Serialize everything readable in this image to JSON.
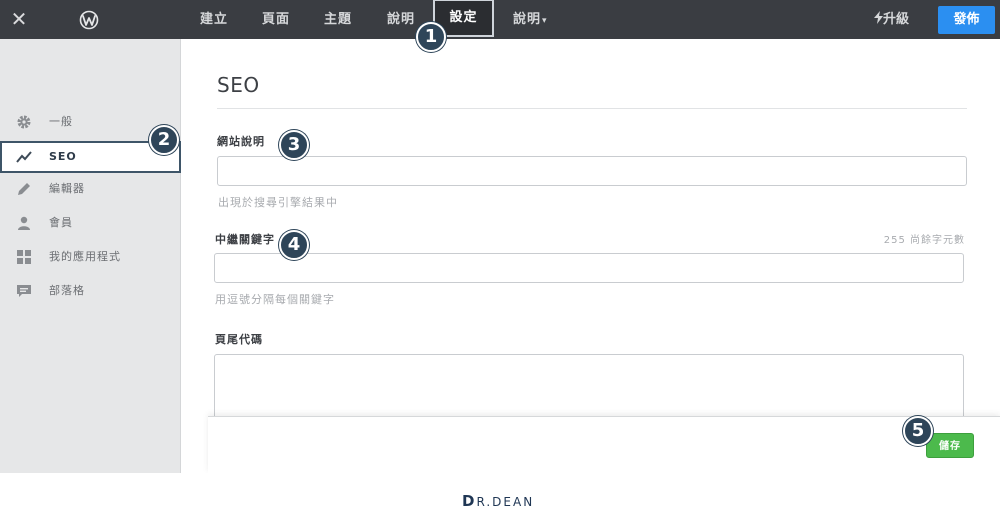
{
  "topbar": {
    "close_glyph": "✕",
    "nav": [
      "建立",
      "頁面",
      "主題",
      "說明",
      "設定",
      "說明"
    ],
    "help_caret": "▾",
    "upgrade": "升級",
    "publish": "發佈"
  },
  "sidebar": {
    "items": [
      {
        "label": "一般",
        "icon": "gear-icon"
      },
      {
        "label": "SEO",
        "icon": "trend-icon"
      },
      {
        "label": "編輯器",
        "icon": "pencil-icon"
      },
      {
        "label": "會員",
        "icon": "user-icon"
      },
      {
        "label": "我的應用程式",
        "icon": "apps-icon"
      },
      {
        "label": "部落格",
        "icon": "comment-icon"
      }
    ]
  },
  "main": {
    "title": "SEO",
    "site_desc_label": "網站說明",
    "site_desc_value": "",
    "site_desc_hint": "出現於搜尋引擎結果中",
    "keywords_label": "中繼關鍵字",
    "keywords_counter": "255 尚餘字元數",
    "keywords_value": "",
    "keywords_hint": "用逗號分隔每個關鍵字",
    "footer_code_label": "頁尾代碼",
    "footer_code_value": ""
  },
  "footer": {
    "save": "儲存"
  },
  "markers": [
    "1",
    "2",
    "3",
    "4",
    "5"
  ],
  "brand": {
    "d": "D",
    "rest": "R.DEAN"
  },
  "colors": {
    "topbar": "#3a3d42",
    "publish": "#2b8ff1",
    "save": "#4cba4c",
    "marker": "#2e4559",
    "sidebar": "#e6e7e8"
  }
}
